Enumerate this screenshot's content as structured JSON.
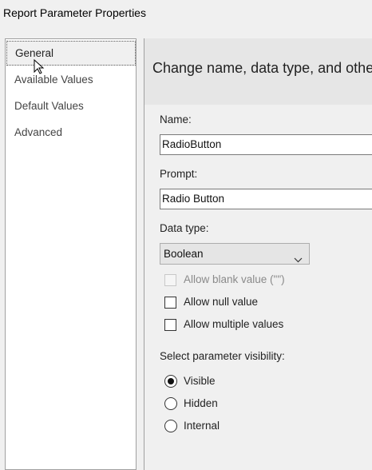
{
  "window": {
    "title": "Report Parameter Properties"
  },
  "nav": {
    "items": [
      {
        "label": "General",
        "selected": true
      },
      {
        "label": "Available Values",
        "selected": false
      },
      {
        "label": "Default Values",
        "selected": false
      },
      {
        "label": "Advanced",
        "selected": false
      }
    ]
  },
  "main": {
    "header": "Change name, data type, and othe",
    "name_label": "Name:",
    "name_value": "RadioButton",
    "prompt_label": "Prompt:",
    "prompt_value": "Radio Button",
    "datatype_label": "Data type:",
    "datatype_value": "Boolean",
    "checkboxes": {
      "allow_blank": {
        "label": "Allow blank value (\"\")",
        "checked": false,
        "enabled": false
      },
      "allow_null": {
        "label": "Allow null value",
        "checked": false,
        "enabled": true
      },
      "allow_multiple": {
        "label": "Allow multiple values",
        "checked": false,
        "enabled": true
      }
    },
    "visibility_label": "Select parameter visibility:",
    "visibility_options": [
      {
        "label": "Visible",
        "selected": true
      },
      {
        "label": "Hidden",
        "selected": false
      },
      {
        "label": "Internal",
        "selected": false
      }
    ]
  },
  "icons": {
    "cursor": "mouse-pointer-icon",
    "dropdown": "chevron-down-icon"
  }
}
